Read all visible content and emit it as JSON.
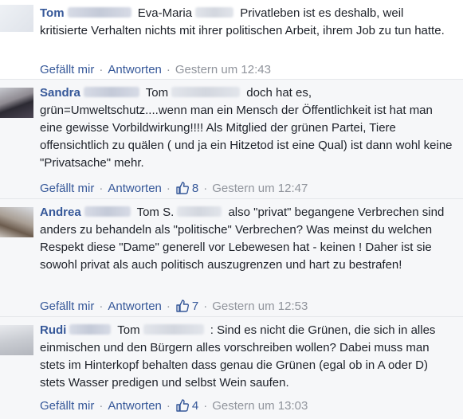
{
  "comments": [
    {
      "name": "Tom",
      "mention": "Eva-Maria",
      "text": "Privatleben ist es deshalb, weil kritisierte Verhalten nichts mit ihrer politischen Arbeit, ihrem Job zu tun hatte.",
      "like_label": "Gefällt mir",
      "reply_label": "Antworten",
      "likes": "",
      "time": "Gestern um 12:43"
    },
    {
      "name": "Sandra",
      "mention": "Tom",
      "text_line1": "doch hat es,",
      "text": "grün=Umweltschutz....wenn man ein Mensch der Öffentlichkeit ist hat man eine gewisse Vorbildwirkung!!!! Als Mitglied der grünen Partei, Tiere offensichtlich zu quälen ( und ja ein Hitzetod ist eine Qual) ist dann wohl keine \"Privatsache\" mehr.",
      "like_label": "Gefällt mir",
      "reply_label": "Antworten",
      "likes": "8",
      "time": "Gestern um 12:47"
    },
    {
      "name": "Andrea",
      "mention": "Tom S.",
      "text_line1": "also \"privat\" begangene Verbrechen",
      "text": "sind anders zu behandeln als \"politische\" Verbrechen? Was meinst du welchen Respekt diese \"Dame\" generell vor Lebewesen hat - keinen ! Daher ist sie sowohl privat als auch politisch auszugrenzen und hart zu bestrafen!",
      "like_label": "Gefällt mir",
      "reply_label": "Antworten",
      "likes": "7",
      "time": "Gestern um 12:53"
    },
    {
      "name": "Rudi",
      "mention": "Tom",
      "text_line1": ": Sind es nicht die Grünen, die sich in",
      "text": "alles einmischen und den Bürgern alles vorschreiben wollen? Dabei muss man stets im Hinterkopf behalten dass genau die Grünen (egal ob in A oder D) stets Wasser predigen und selbst Wein saufen.",
      "like_label": "Gefällt mir",
      "reply_label": "Antworten",
      "likes": "4",
      "time": "Gestern um 13:03"
    }
  ],
  "colors": {
    "link": "#365899",
    "meta": "#90949c",
    "text": "#1d2129",
    "bg_alt": "#f6f7f9"
  },
  "icons": {
    "like": "thumbs-up-icon"
  }
}
